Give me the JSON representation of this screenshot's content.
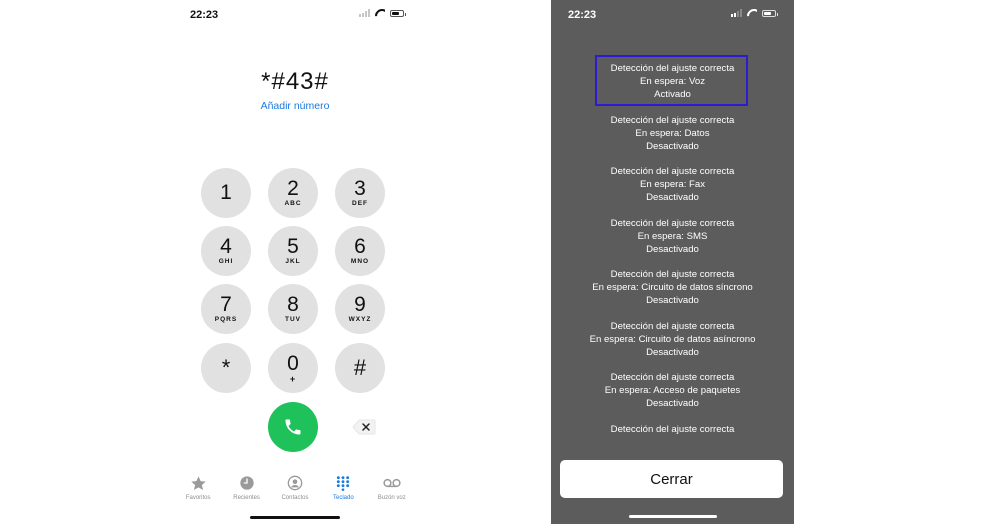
{
  "left_screen": {
    "status_time": "22:23",
    "dialed_number": "*#43#",
    "add_number_link": "Añadir número",
    "keys": [
      {
        "digit": "1",
        "letters": ""
      },
      {
        "digit": "2",
        "letters": "ABC"
      },
      {
        "digit": "3",
        "letters": "DEF"
      },
      {
        "digit": "4",
        "letters": "GHI"
      },
      {
        "digit": "5",
        "letters": "JKL"
      },
      {
        "digit": "6",
        "letters": "MNO"
      },
      {
        "digit": "7",
        "letters": "PQRS"
      },
      {
        "digit": "8",
        "letters": "TUV"
      },
      {
        "digit": "9",
        "letters": "WXYZ"
      },
      {
        "digit": "*",
        "letters": ""
      },
      {
        "digit": "0",
        "letters": "+"
      },
      {
        "digit": "#",
        "letters": ""
      }
    ],
    "tabs": [
      {
        "label": "Favoritos",
        "icon": "star-icon",
        "active": false
      },
      {
        "label": "Recientes",
        "icon": "clock-icon",
        "active": false
      },
      {
        "label": "Contactos",
        "icon": "person-icon",
        "active": false
      },
      {
        "label": "Teclado",
        "icon": "keypad-icon",
        "active": true
      },
      {
        "label": "Buzón voz",
        "icon": "voicemail-icon",
        "active": false
      }
    ],
    "colors": {
      "call": "#1fc25a",
      "accent": "#1a7ae0",
      "key": "#e1e1e1"
    }
  },
  "right_screen": {
    "status_time": "22:23",
    "results": [
      {
        "line1": "Detección del ajuste correcta",
        "line2": "En espera: Voz",
        "line3": "Activado"
      },
      {
        "line1": "Detección del ajuste correcta",
        "line2": "En espera: Datos",
        "line3": "Desactivado"
      },
      {
        "line1": "Detección del ajuste correcta",
        "line2": "En espera: Fax",
        "line3": "Desactivado"
      },
      {
        "line1": "Detección del ajuste correcta",
        "line2": "En espera: SMS",
        "line3": "Desactivado"
      },
      {
        "line1": "Detección del ajuste correcta",
        "line2": "En espera: Circuito de datos síncrono",
        "line3": "Desactivado"
      },
      {
        "line1": "Detección del ajuste correcta",
        "line2": "En espera: Circuito de datos asíncrono",
        "line3": "Desactivado"
      },
      {
        "line1": "Detección del ajuste correcta",
        "line2": "En espera: Acceso de paquetes",
        "line3": "Desactivado"
      },
      {
        "line1": "Detección del ajuste correcta",
        "line2": "",
        "line3": ""
      }
    ],
    "close_button": "Cerrar",
    "colors": {
      "background": "#5c5c5c",
      "highlight_border": "#2b1bd6"
    }
  }
}
